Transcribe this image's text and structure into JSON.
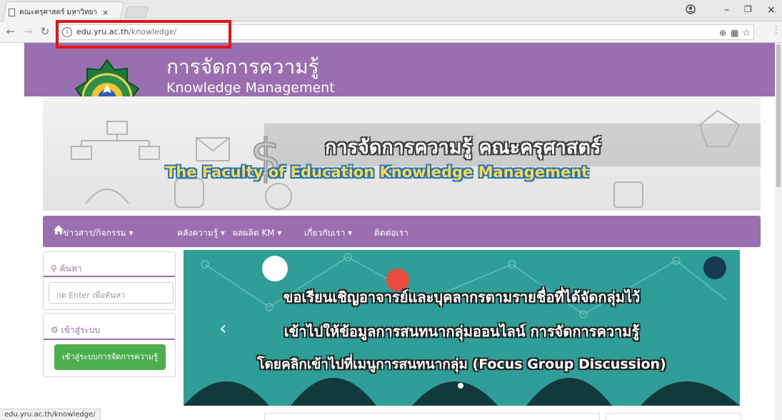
{
  "browser": {
    "tab_title": "คณะครุศาสตร์ มหาวิทยาลัยร",
    "tab_close": "×",
    "url_host": "edu.yru.ac.th",
    "url_path": "/knowledge/",
    "status_url": "edu.yru.ac.th/knowledge/",
    "window_controls": [
      "–",
      "❐",
      "×"
    ]
  },
  "site": {
    "title_th": "การจัดการความรู้",
    "title_en": "Knowledge Management",
    "banner_th": "การจัดการความรู้ คณะครุศาสตร์",
    "banner_en": "The Faculty of Education Knowledge Management"
  },
  "nav": {
    "items": [
      {
        "label": "ข่าวสาร/กิจกรรม ▾"
      },
      {
        "label": "คลังความรู้ ▾"
      },
      {
        "label": "ผลผลิต KM ▾"
      },
      {
        "label": "เกี่ยวกับเรา ▾"
      },
      {
        "label": "ติดต่อเรา"
      }
    ]
  },
  "sidebar": {
    "search_title": "ค้นหา",
    "search_placeholder": "กด Enter เพื่อค้นหา",
    "login_title": "เข้าสู่ระบบ",
    "login_button": "เข้าสู่ระบบการจัดการความรู้"
  },
  "carousel": {
    "lines": [
      "ขอเรียนเชิญอาจารย์และบุคลากรตามรายชื่อที่ได้จัดกลุ่มไว้",
      "เข้าไปให้ข้อมูลการสนทนากลุ่มออนไลน์ การจัดการความรู้",
      "โดยคลิกเข้าไปที่เมนูการสนทนากลุ่ม (Focus Group Discussion)"
    ],
    "prev": "‹"
  },
  "colors": {
    "brand_purple": "#9a6fb0",
    "login_green": "#4cae4c",
    "carousel_teal": "#2e9e96",
    "highlight_red": "#e01515"
  }
}
